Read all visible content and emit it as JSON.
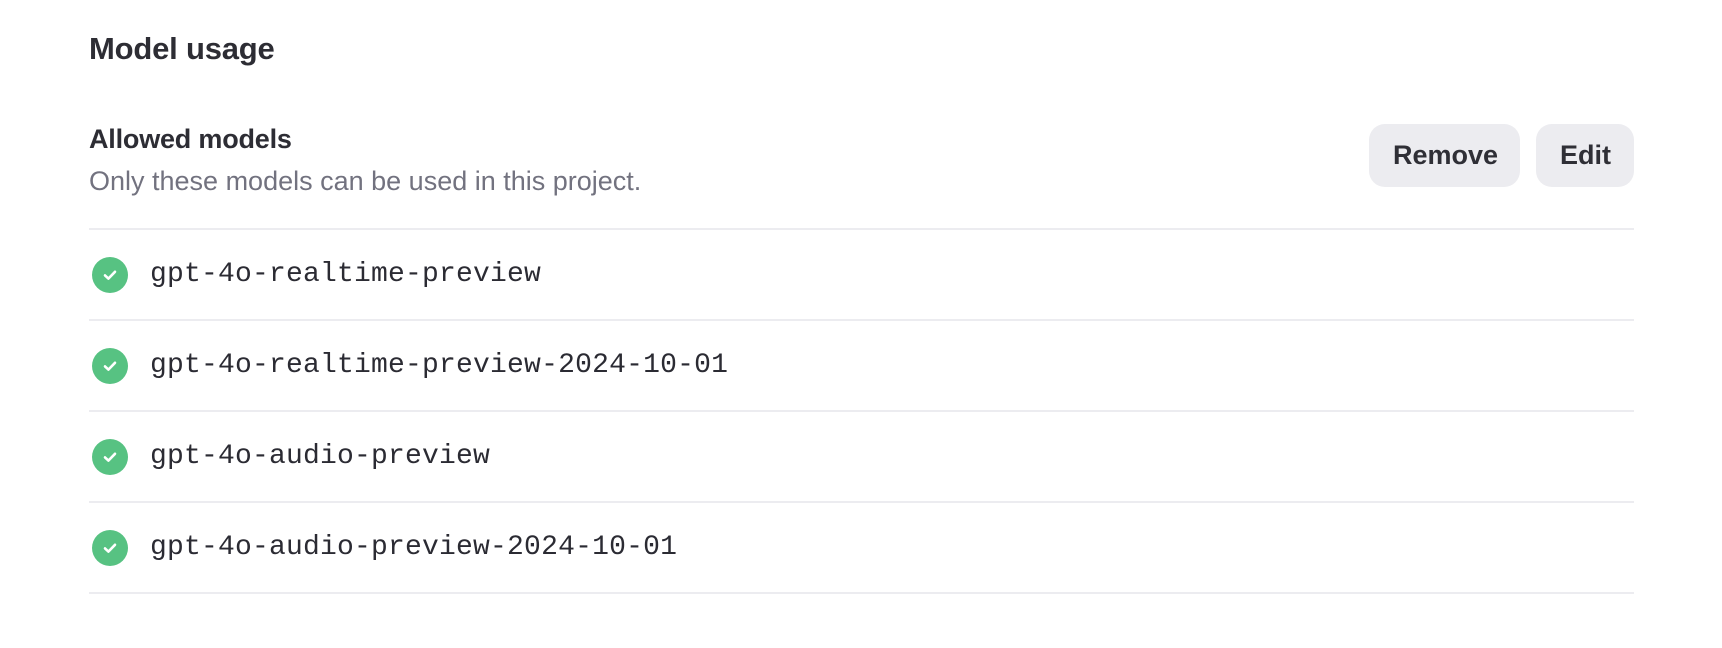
{
  "section": {
    "title": "Model usage"
  },
  "allowed_models": {
    "title": "Allowed models",
    "description": "Only these models can be used in this project.",
    "buttons": {
      "remove": "Remove",
      "edit": "Edit"
    },
    "items": [
      {
        "name": "gpt-4o-realtime-preview",
        "status_icon": "check-circle-icon"
      },
      {
        "name": "gpt-4o-realtime-preview-2024-10-01",
        "status_icon": "check-circle-icon"
      },
      {
        "name": "gpt-4o-audio-preview",
        "status_icon": "check-circle-icon"
      },
      {
        "name": "gpt-4o-audio-preview-2024-10-01",
        "status_icon": "check-circle-icon"
      }
    ]
  },
  "colors": {
    "success": "#57c282",
    "button_bg": "#ececf0",
    "divider": "#ececf0",
    "muted_text": "#72727f",
    "primary_text": "#2d2d34"
  }
}
